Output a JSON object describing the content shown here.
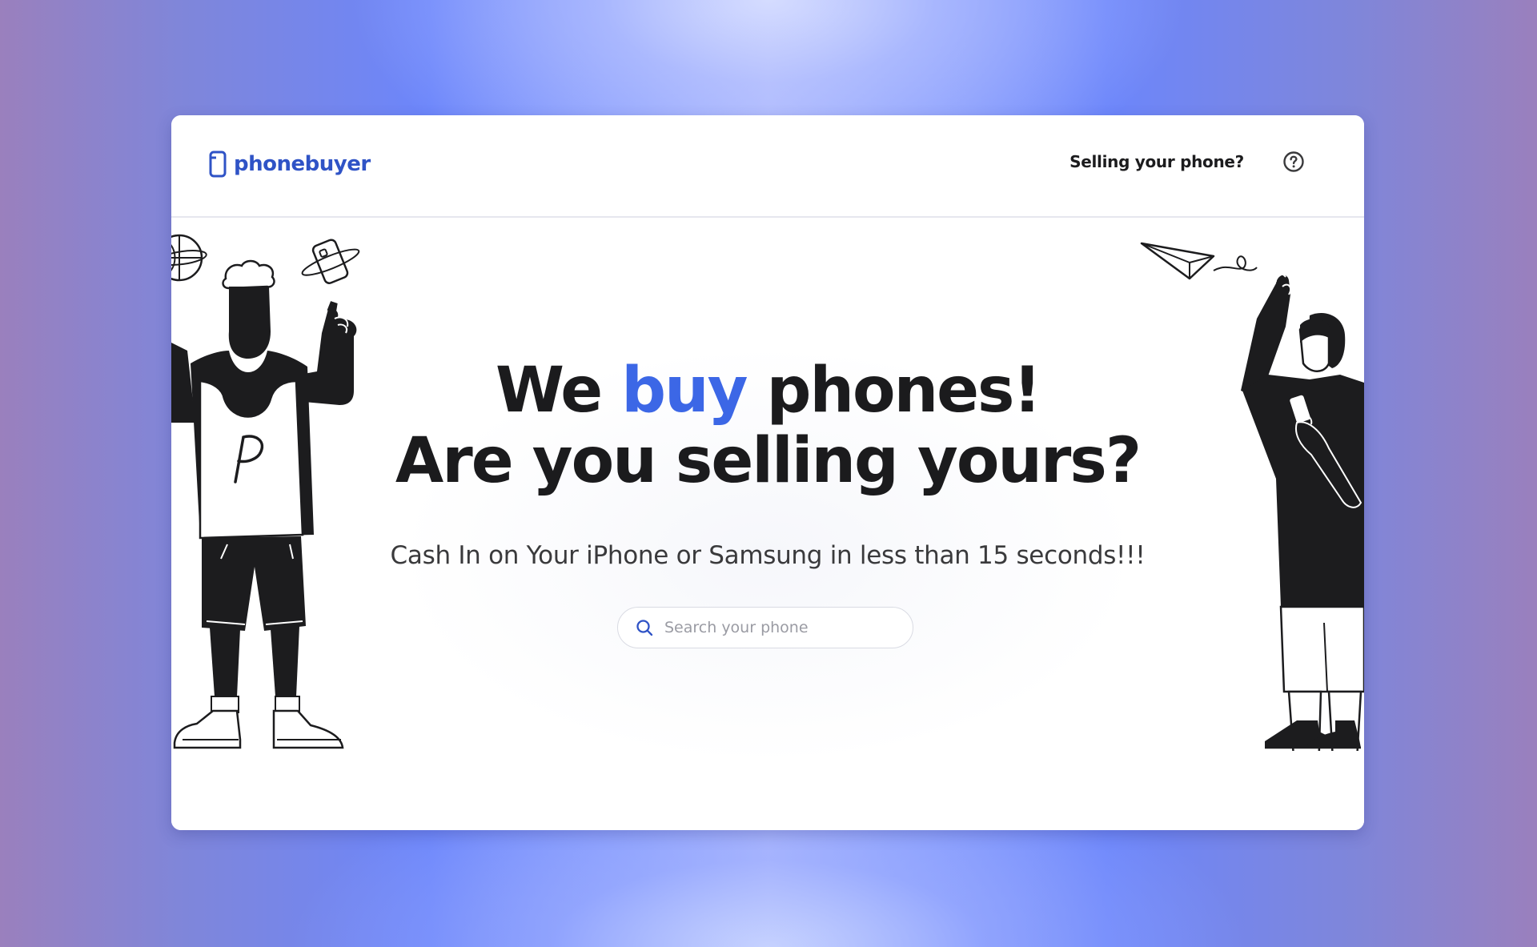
{
  "brand": {
    "name": "phonebuyer",
    "color": "#2f53c6"
  },
  "nav": {
    "selling_link": "Selling your phone?",
    "help_icon": "question-circle-icon"
  },
  "hero": {
    "headline_pre": "We ",
    "headline_accent": "buy",
    "headline_post": " phones!",
    "headline_line2": "Are you selling yours?",
    "accent_color": "#3c67e6",
    "subheadline": "Cash In on Your iPhone or Samsung in less than 15 seconds!!!"
  },
  "search": {
    "placeholder": "Search your phone",
    "value": "",
    "icon": "search-icon"
  },
  "illustrations": {
    "left": "basketball-player-illustration",
    "right": "person-with-phone-illustration"
  }
}
